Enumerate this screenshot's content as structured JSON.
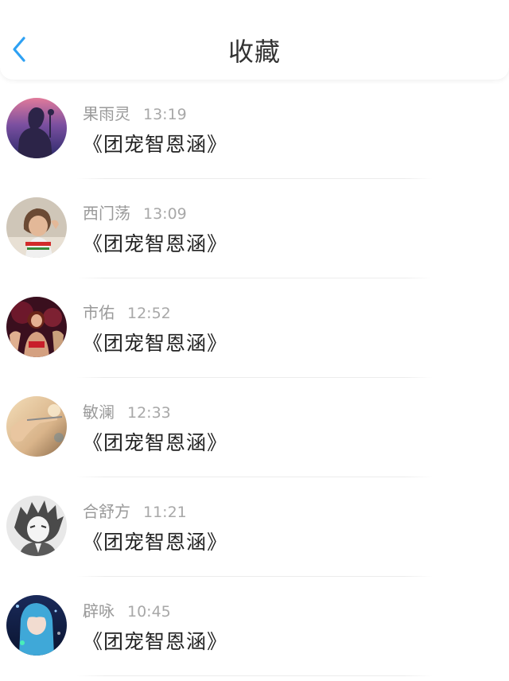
{
  "header": {
    "title": "收藏",
    "back_icon": "chevron-left-icon",
    "accent_color": "#2ea1f3"
  },
  "items": [
    {
      "name": "果雨灵",
      "time": "13:19",
      "text": "《团宠智恩涵》",
      "avatar": "silhouette-avatar"
    },
    {
      "name": "西门荡",
      "time": "13:09",
      "text": "《团宠智恩涵》",
      "avatar": "boy-photo-avatar"
    },
    {
      "name": "市佑",
      "time": "12:52",
      "text": "《团宠智恩涵》",
      "avatar": "dancers-photo-avatar"
    },
    {
      "name": "敏澜",
      "time": "12:33",
      "text": "《团宠智恩涵》",
      "avatar": "hand-photo-avatar"
    },
    {
      "name": "合舒方",
      "time": "11:21",
      "text": "《团宠智恩涵》",
      "avatar": "anime-sketch-avatar"
    },
    {
      "name": "辟咏",
      "time": "10:45",
      "text": "《团宠智恩涵》",
      "avatar": "anime-blue-avatar"
    }
  ]
}
